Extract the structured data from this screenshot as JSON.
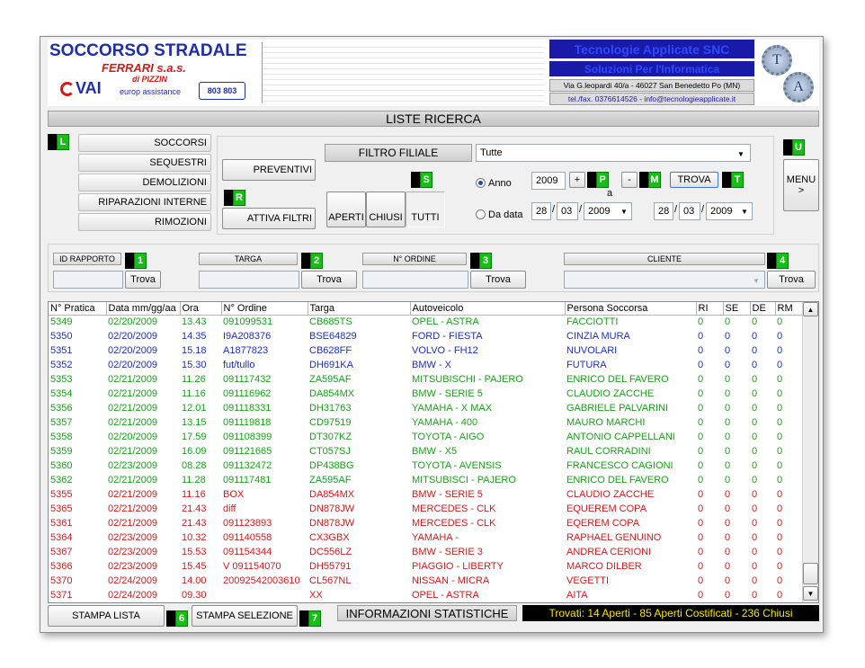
{
  "header": {
    "company_name": "SOCCORSO STRADALE",
    "company_sub": "FERRARI s.a.s.",
    "company_sub2": "di PIZZIN",
    "vai_logo": "VAI",
    "europ": "europ assistance",
    "phone_badge": "803 803",
    "vendor_title": "Tecnologie Applicate SNC",
    "vendor_subtitle": "Soluzioni Per l'Informatica",
    "vendor_address": "Via G.leopardi 40/a - 46027 San Benedetto Po (MN)",
    "vendor_contact": "tel./fax. 0376614526 - info@tecnologieapplicate.it",
    "logo_t": "T",
    "logo_a": "A"
  },
  "title_bar": "LISTE RICERCA",
  "left_menu": {
    "badge": "L",
    "items": [
      "SOCCORSI",
      "SEQUESTRI",
      "DEMOLIZIONI",
      "RIPARAZIONI INTERNE",
      "RIMOZIONI"
    ]
  },
  "filters": {
    "preventivi": "PREVENTIVI",
    "attiva_filtri": "ATTIVA FILTRI",
    "badge_r": "R",
    "badge_s": "S",
    "aperti": "APERTI",
    "chiusi": "CHIUSI",
    "tutti": "TUTTI",
    "filtro_filiale_label": "FILTRO FILIALE",
    "filtro_filiale_value": "Tutte",
    "anno_label": "Anno",
    "anno_value": "2009",
    "plus": "+",
    "minus": "-",
    "badge_p": "P",
    "badge_m": "M",
    "a_label": "a",
    "trova": "TROVA",
    "badge_t": "T",
    "da_data_label": "Da data",
    "from_day": "28",
    "from_month": "03",
    "from_year": "2009",
    "to_day": "28",
    "to_month": "03",
    "to_year": "2009",
    "slash": "/"
  },
  "right": {
    "badge_u": "U",
    "menu": "MENU",
    "menu_arrow": ">"
  },
  "search": {
    "id_rapporto": "ID RAPPORTO",
    "targa": "TARGA",
    "n_ordine": "N° ORDINE",
    "cliente": "CLIENTE",
    "trova": "Trova",
    "badges": [
      "1",
      "2",
      "3",
      "4"
    ]
  },
  "table": {
    "headers": [
      "N° Pratica",
      "Data mm/gg/aa",
      "Ora",
      "N° Ordine",
      "Targa",
      "Autoveicolo",
      "Persona Soccorsa",
      "RI",
      "SE",
      "DE",
      "RM"
    ],
    "rows": [
      {
        "c": "green",
        "v": [
          "5349",
          "02/20/2009",
          "13.43",
          "091099531",
          "CB685TS",
          "OPEL - ASTRA",
          "FACCIOTTI",
          "0",
          "0",
          "0",
          "0"
        ]
      },
      {
        "c": "blue",
        "v": [
          "5350",
          "02/20/2009",
          "14.35",
          "I9A208376",
          "BSE64829",
          "FORD - FIESTA",
          "CINZIA MURA",
          "0",
          "0",
          "0",
          "0"
        ]
      },
      {
        "c": "blue",
        "v": [
          "5351",
          "02/20/2009",
          "15.18",
          "A1877823",
          "CB628FF",
          "VOLVO - FH12",
          "NUVOLARI",
          "0",
          "0",
          "0",
          "0"
        ]
      },
      {
        "c": "blue",
        "v": [
          "5352",
          "02/20/2009",
          "15.30",
          "fut/tullo",
          "DH691KA",
          "BMW - X",
          "FUTURA",
          "0",
          "0",
          "0",
          "0"
        ]
      },
      {
        "c": "green",
        "v": [
          "5353",
          "02/21/2009",
          "11.26",
          "091117432",
          "ZA595AF",
          "MITSUBISCHI - PAJERO",
          "ENRICO DEL FAVERO",
          "0",
          "0",
          "0",
          "0"
        ]
      },
      {
        "c": "green",
        "v": [
          "5354",
          "02/21/2009",
          "11.16",
          "091116962",
          "DA854MX",
          "BMW - SERIE 5",
          "CLAUDIO ZACCHE",
          "0",
          "0",
          "0",
          "0"
        ]
      },
      {
        "c": "green",
        "v": [
          "5356",
          "02/21/2009",
          "12.01",
          "091118331",
          "DH31763",
          "YAMAHA - X MAX",
          "GABRIELE PALVARINI",
          "0",
          "0",
          "0",
          "0"
        ]
      },
      {
        "c": "green",
        "v": [
          "5357",
          "02/21/2009",
          "13.15",
          "091119818",
          "CD97519",
          "YAMAHA - 400",
          "MAURO MARCHI",
          "0",
          "0",
          "0",
          "0"
        ]
      },
      {
        "c": "green",
        "v": [
          "5358",
          "02/20/2009",
          "17.59",
          "091108399",
          "DT307KZ",
          "TOYOTA - AIGO",
          "ANTONIO CAPPELLANI",
          "0",
          "0",
          "0",
          "0"
        ]
      },
      {
        "c": "green",
        "v": [
          "5359",
          "02/21/2009",
          "16.09",
          "091121665",
          "CT057SJ",
          "BMW - X5",
          "RAUL CORRADINI",
          "0",
          "0",
          "0",
          "0"
        ]
      },
      {
        "c": "green",
        "v": [
          "5360",
          "02/23/2009",
          "08.28",
          "091132472",
          "DP438BG",
          "TOYOTA - AVENSIS",
          "FRANCESCO CAGIONI",
          "0",
          "0",
          "0",
          "0"
        ]
      },
      {
        "c": "green",
        "v": [
          "5362",
          "02/21/2009",
          "11.28",
          "091117481",
          "ZA595AF",
          "MITSUBISCI - PAJERO",
          "ENRICO DEL FAVERO",
          "0",
          "0",
          "0",
          "0"
        ]
      },
      {
        "c": "red",
        "v": [
          "5355",
          "02/21/2009",
          "11.16",
          "BOX",
          "DA854MX",
          "BMW - SERIE 5",
          "CLAUDIO ZACCHE",
          "0",
          "0",
          "0",
          "0"
        ]
      },
      {
        "c": "red",
        "v": [
          "5365",
          "02/21/2009",
          "21.43",
          "diff",
          "DN878JW",
          "MERCEDES - CLK",
          "EQUEREM COPA",
          "0",
          "0",
          "0",
          "0"
        ]
      },
      {
        "c": "red",
        "v": [
          "5361",
          "02/21/2009",
          "21.43",
          "091123893",
          "DN878JW",
          "MERCEDES - CLK",
          "EQEREM COPA",
          "0",
          "0",
          "0",
          "0"
        ]
      },
      {
        "c": "red",
        "v": [
          "5364",
          "02/23/2009",
          "10.32",
          "091140558",
          "CX3GBX",
          "YAMAHA -",
          "RAPHAEL GENUINO",
          "0",
          "0",
          "0",
          "0"
        ]
      },
      {
        "c": "red",
        "v": [
          "5367",
          "02/23/2009",
          "15.53",
          "091154344",
          "DC556LZ",
          "BMW - SERIE 3",
          "ANDREA CERIONI",
          "0",
          "0",
          "0",
          "0"
        ]
      },
      {
        "c": "red",
        "v": [
          "5366",
          "02/23/2009",
          "15.45",
          "V 091154070",
          "DH55791",
          "PIAGGIO - LIBERTY",
          "MARCO DILBER",
          "0",
          "0",
          "0",
          "0"
        ]
      },
      {
        "c": "red",
        "v": [
          "5370",
          "02/24/2009",
          "14.00",
          "20092542003610",
          "CL567NL",
          "NISSAN - MICRA",
          "VEGETTI",
          "0",
          "0",
          "0",
          "0"
        ]
      },
      {
        "c": "red",
        "v": [
          "5371",
          "02/24/2009",
          "09.30",
          "",
          "XX",
          "OPEL - ASTRA",
          "AITA",
          "0",
          "0",
          "0",
          "0"
        ]
      }
    ]
  },
  "footer": {
    "stampa_lista": "STAMPA LISTA",
    "badge_6": "6",
    "stampa_selezione": "STAMPA SELEZIONE",
    "badge_7": "7",
    "info_stat": "INFORMAZIONI STATISTICHE",
    "trovati": "Trovati:  14 Aperti - 85 Aperti Costificati - 236 Chiusi"
  },
  "colors": {
    "green": "#16a216",
    "blue": "#1c2fc2",
    "red": "#d21a1a",
    "badge_green": "#14c014",
    "vendor_blue": "#1a1aa8",
    "status_yellow": "#f5e600"
  }
}
